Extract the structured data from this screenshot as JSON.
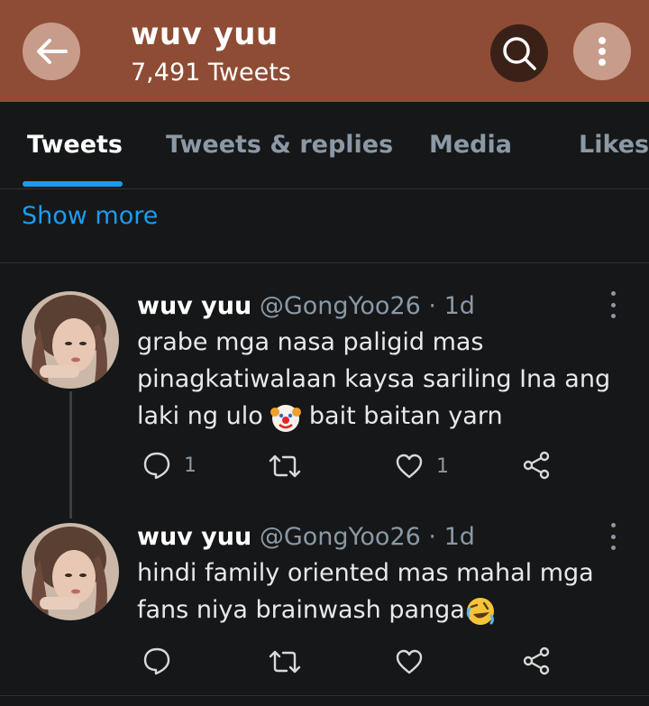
{
  "header": {
    "title": "wuv yuu",
    "subtitle": "7,491 Tweets",
    "color": "#8e4c35"
  },
  "tabs": [
    {
      "label": "Tweets",
      "active": true
    },
    {
      "label": "Tweets & replies",
      "active": false
    },
    {
      "label": "Media",
      "active": false
    },
    {
      "label": "Likes",
      "active": false
    }
  ],
  "show_more": "Show more",
  "tweets": [
    {
      "name": "wuv yuu",
      "handle": "@GongYoo26",
      "time": "· 1d",
      "text_1": "grabe mga nasa paligid mas",
      "text_2": "pinagkatiwalaan kaysa sariling Ina ang",
      "text_3a": "laki ng ulo",
      "emoji": "clown-face",
      "text_3b": "bait baitan yarn",
      "replies": "1",
      "retweets": "",
      "likes": "1"
    },
    {
      "name": "wuv yuu",
      "handle": "@GongYoo26",
      "time": "· 1d",
      "text_1": "hindi family oriented mas mahal mga",
      "text_2": "fans niya brainwash panga",
      "emoji": "rolling-on-floor-laughing",
      "replies": "",
      "retweets": "",
      "likes": ""
    }
  ],
  "icons": {
    "back": "arrow-left-icon",
    "search": "search-icon",
    "more": "more-vertical-icon",
    "reply": "comment-icon",
    "retweet": "retweet-icon",
    "like": "heart-icon",
    "share": "share-icon"
  }
}
